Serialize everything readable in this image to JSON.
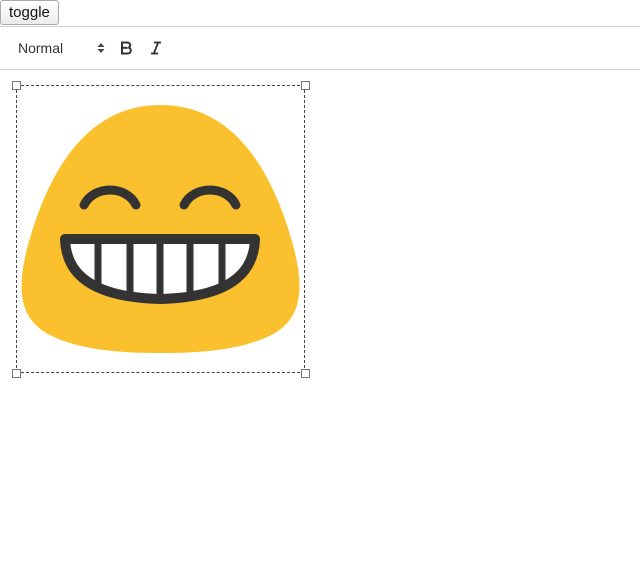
{
  "toggle_button": {
    "label": "toggle"
  },
  "toolbar": {
    "format_select": {
      "value": "Normal",
      "icon": "up-down-arrows-icon"
    },
    "bold": {
      "label": "B",
      "icon": "bold-icon"
    },
    "italic": {
      "label": "I",
      "icon": "italic-icon"
    }
  },
  "editor": {
    "image": {
      "subject": "grinning-face-with-smiling-eyes-emoji",
      "selected": true,
      "colors": {
        "face": "#FBC02D",
        "features": "#333333",
        "teeth": "#FFFFFF"
      }
    }
  }
}
